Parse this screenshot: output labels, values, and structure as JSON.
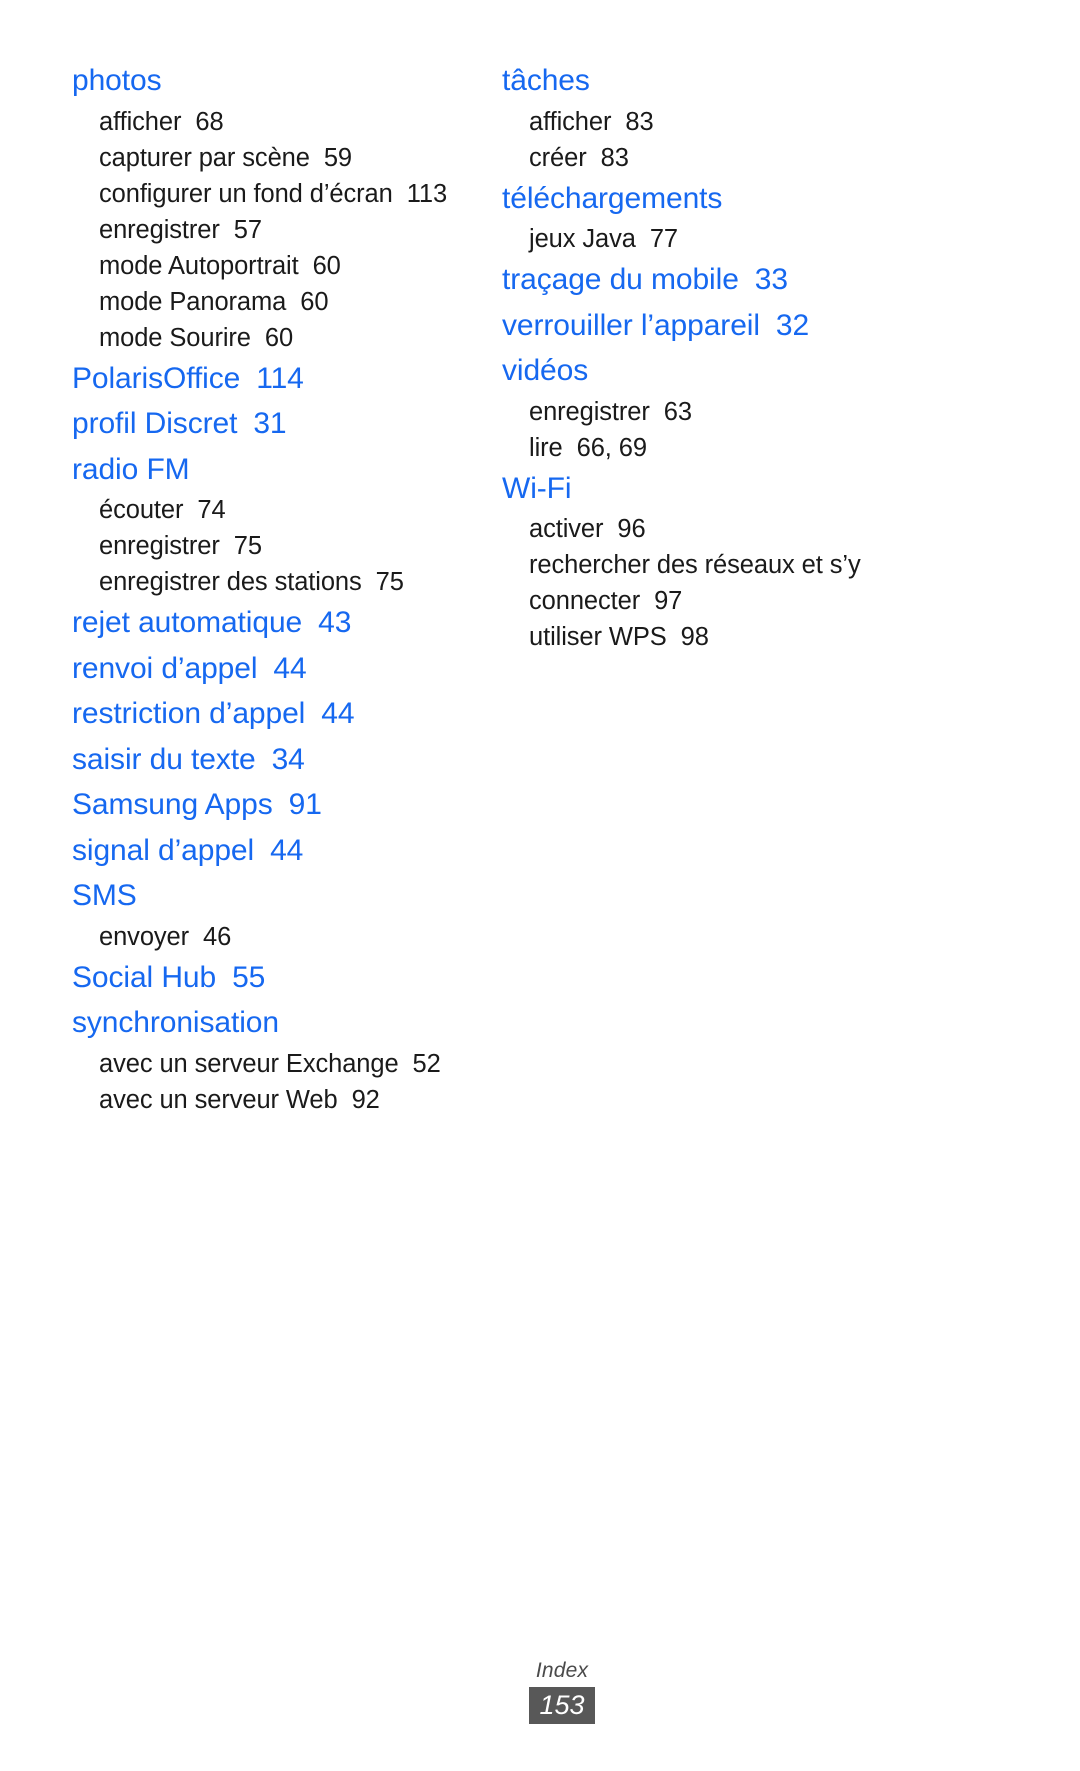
{
  "page": {
    "footer_label": "Index",
    "footer_page_number": "153",
    "heading_color": "#1668f0",
    "footer_box_color": "#585858"
  },
  "columns": [
    {
      "name": "left-column",
      "entries": [
        {
          "term": "photos",
          "page": "",
          "subentries": [
            {
              "text": "afficher",
              "page": "68"
            },
            {
              "text": "capturer par scène",
              "page": "59"
            },
            {
              "text": "configurer un fond d’écran",
              "page": "113",
              "wrap": true
            },
            {
              "text": "enregistrer",
              "page": "57"
            },
            {
              "text": "mode Autoportrait",
              "page": "60"
            },
            {
              "text": "mode Panorama",
              "page": "60"
            },
            {
              "text": "mode Sourire",
              "page": "60"
            }
          ]
        },
        {
          "term": "PolarisOffice",
          "page": "114",
          "subentries": []
        },
        {
          "term": "profil Discret",
          "page": "31",
          "subentries": []
        },
        {
          "term": "radio FM",
          "page": "",
          "subentries": [
            {
              "text": "écouter",
              "page": "74"
            },
            {
              "text": "enregistrer",
              "page": "75"
            },
            {
              "text": "enregistrer des stations",
              "page": "75"
            }
          ]
        },
        {
          "term": "rejet automatique",
          "page": "43",
          "subentries": []
        },
        {
          "term": "renvoi d’appel",
          "page": "44",
          "subentries": []
        },
        {
          "term": "restriction d’appel",
          "page": "44",
          "subentries": []
        },
        {
          "term": "saisir du texte",
          "page": "34",
          "subentries": []
        },
        {
          "term": "Samsung Apps",
          "page": "91",
          "subentries": []
        },
        {
          "term": "signal d’appel",
          "page": "44",
          "subentries": []
        },
        {
          "term": "SMS",
          "page": "",
          "subentries": [
            {
              "text": "envoyer",
              "page": "46"
            }
          ]
        },
        {
          "term": "Social Hub",
          "page": "55",
          "subentries": []
        },
        {
          "term": "synchronisation",
          "page": "",
          "subentries": [
            {
              "text": "avec un serveur Exchange",
              "page": "52",
              "wrap": true
            },
            {
              "text": "avec un serveur Web",
              "page": "92"
            }
          ]
        }
      ]
    },
    {
      "name": "right-column",
      "entries": [
        {
          "term": "tâches",
          "page": "",
          "subentries": [
            {
              "text": "afficher",
              "page": "83"
            },
            {
              "text": "créer",
              "page": "83"
            }
          ]
        },
        {
          "term": "téléchargements",
          "page": "",
          "subentries": [
            {
              "text": "jeux Java",
              "page": "77"
            }
          ]
        },
        {
          "term": "traçage du mobile",
          "page": "33",
          "subentries": []
        },
        {
          "term": "verrouiller l’appareil",
          "page": "32",
          "subentries": []
        },
        {
          "term": "vidéos",
          "page": "",
          "subentries": [
            {
              "text": "enregistrer",
              "page": "63"
            },
            {
              "text": "lire",
              "page": "66, 69"
            }
          ]
        },
        {
          "term": "Wi-Fi",
          "page": "",
          "subentries": [
            {
              "text": "activer",
              "page": "96"
            },
            {
              "text": "rechercher des réseaux et s’y connecter",
              "page": "97",
              "wrap": true
            },
            {
              "text": "utiliser WPS",
              "page": "98"
            }
          ]
        }
      ]
    }
  ]
}
